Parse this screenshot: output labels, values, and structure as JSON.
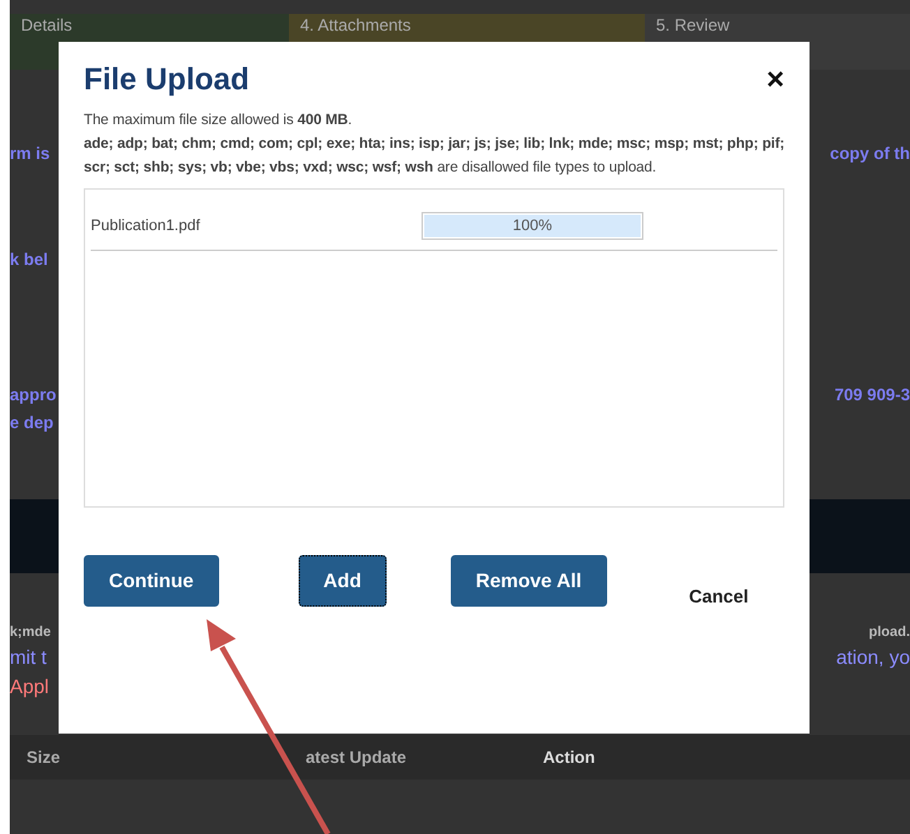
{
  "background": {
    "steps": [
      {
        "label": "Details",
        "color": "#2c3a2a"
      },
      {
        "label": "4. Attachments",
        "color": "#4a4526"
      },
      {
        "label": "5. Review",
        "color": "#3a3a3a"
      }
    ],
    "lines": [
      {
        "left": "rm is",
        "right": "copy of th"
      },
      {
        "left": "k bel"
      },
      {
        "left": "appro",
        "right": "709 909-3"
      },
      {
        "left": "e dep"
      }
    ],
    "notes": [
      {
        "left": "k;mde",
        "right": "pload.",
        "kind": "small"
      },
      {
        "left": "mit t",
        "right": "ation, yo",
        "kind": "large"
      },
      {
        "left": "Appl",
        "kind": "alert"
      }
    ],
    "table_columns": [
      "Size",
      "atest Update",
      "Action"
    ]
  },
  "dialog": {
    "title": "File Upload",
    "close": "×",
    "size_note": "The maximum file size allowed is **400 MB**.",
    "types_note": "**ade; adp; bat; chm; cmd; com; cpl; exe; hta; ins; isp; jar; js; jse; lib; lnk; mde; msc; msp; mst; php; pif; scr; sct; shb; sys; vb; vbe; vbs; vxd; wsc; wsf; wsh** are disallowed file types to upload.",
    "files": [
      {
        "name": "Publication1.pdf",
        "level": 1.0,
        "reading": "100%"
      }
    ],
    "buttons": [
      {
        "label": "Continue",
        "kind": "primary",
        "focused": false
      },
      {
        "label": "Add",
        "kind": "primary",
        "focused": true
      },
      {
        "label": "Remove All",
        "kind": "primary",
        "focused": false
      },
      {
        "label": "Cancel",
        "kind": "link",
        "focused": false
      }
    ]
  }
}
